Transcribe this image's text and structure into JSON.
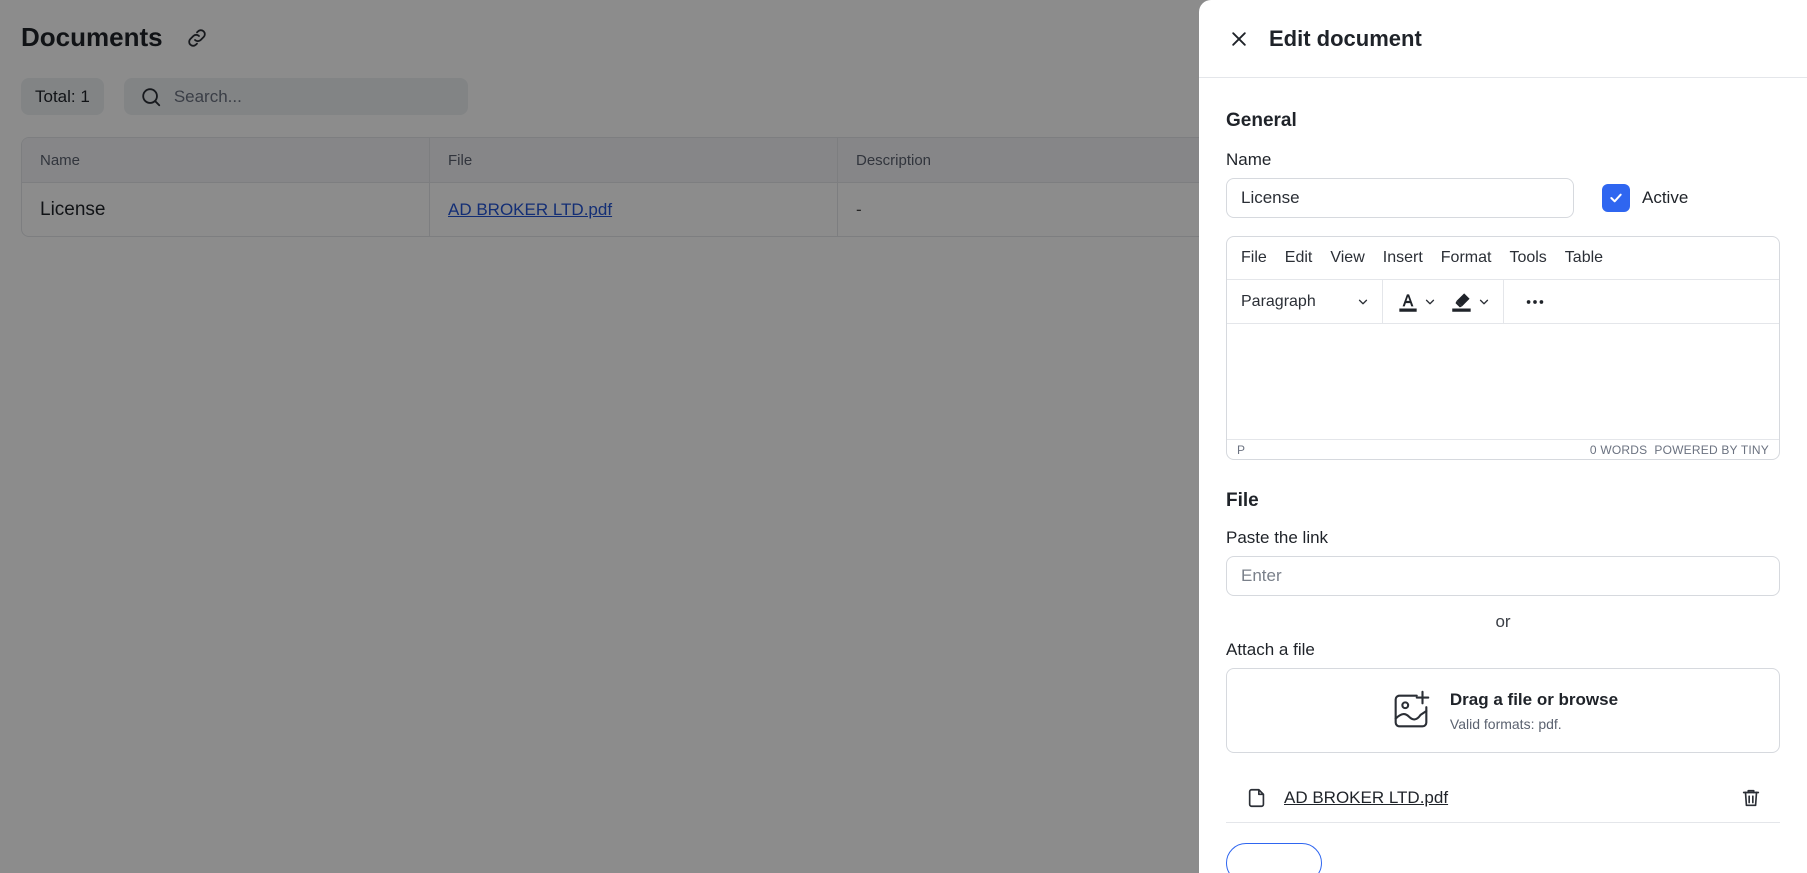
{
  "page": {
    "title": "Documents",
    "total_label": "Total: 1",
    "search_placeholder": "Search..."
  },
  "table": {
    "columns": [
      "Name",
      "File",
      "Description"
    ],
    "rows": [
      {
        "name": "License",
        "file": "AD BROKER LTD.pdf",
        "description": "-"
      }
    ]
  },
  "drawer": {
    "title": "Edit document",
    "general": {
      "section_title": "General",
      "name_label": "Name",
      "name_value": "License",
      "active_label": "Active",
      "active_checked": true
    },
    "editor": {
      "menu": [
        "File",
        "Edit",
        "View",
        "Insert",
        "Format",
        "Tools",
        "Table"
      ],
      "block_format": "Paragraph",
      "status_path": "P",
      "status_words": "0 WORDS",
      "status_brand": "POWERED BY TINY"
    },
    "file": {
      "section_title": "File",
      "paste_label": "Paste the link",
      "link_placeholder": "Enter",
      "or_text": "or",
      "attach_label": "Attach a file",
      "dropzone_title": "Drag a file or browse",
      "dropzone_subtitle": "Valid formats: pdf.",
      "attached_file": "AD BROKER LTD.pdf"
    }
  },
  "colors": {
    "accent": "#2f66f0",
    "link": "#2455d6",
    "overlay": "rgba(0,0,0,0.45)"
  },
  "icons": [
    "link-icon",
    "search-icon",
    "close-icon",
    "checkmark-icon",
    "chevron-down-icon",
    "text-color-icon",
    "highlight-icon",
    "more-icon",
    "image-add-icon",
    "file-icon",
    "trash-icon"
  ]
}
